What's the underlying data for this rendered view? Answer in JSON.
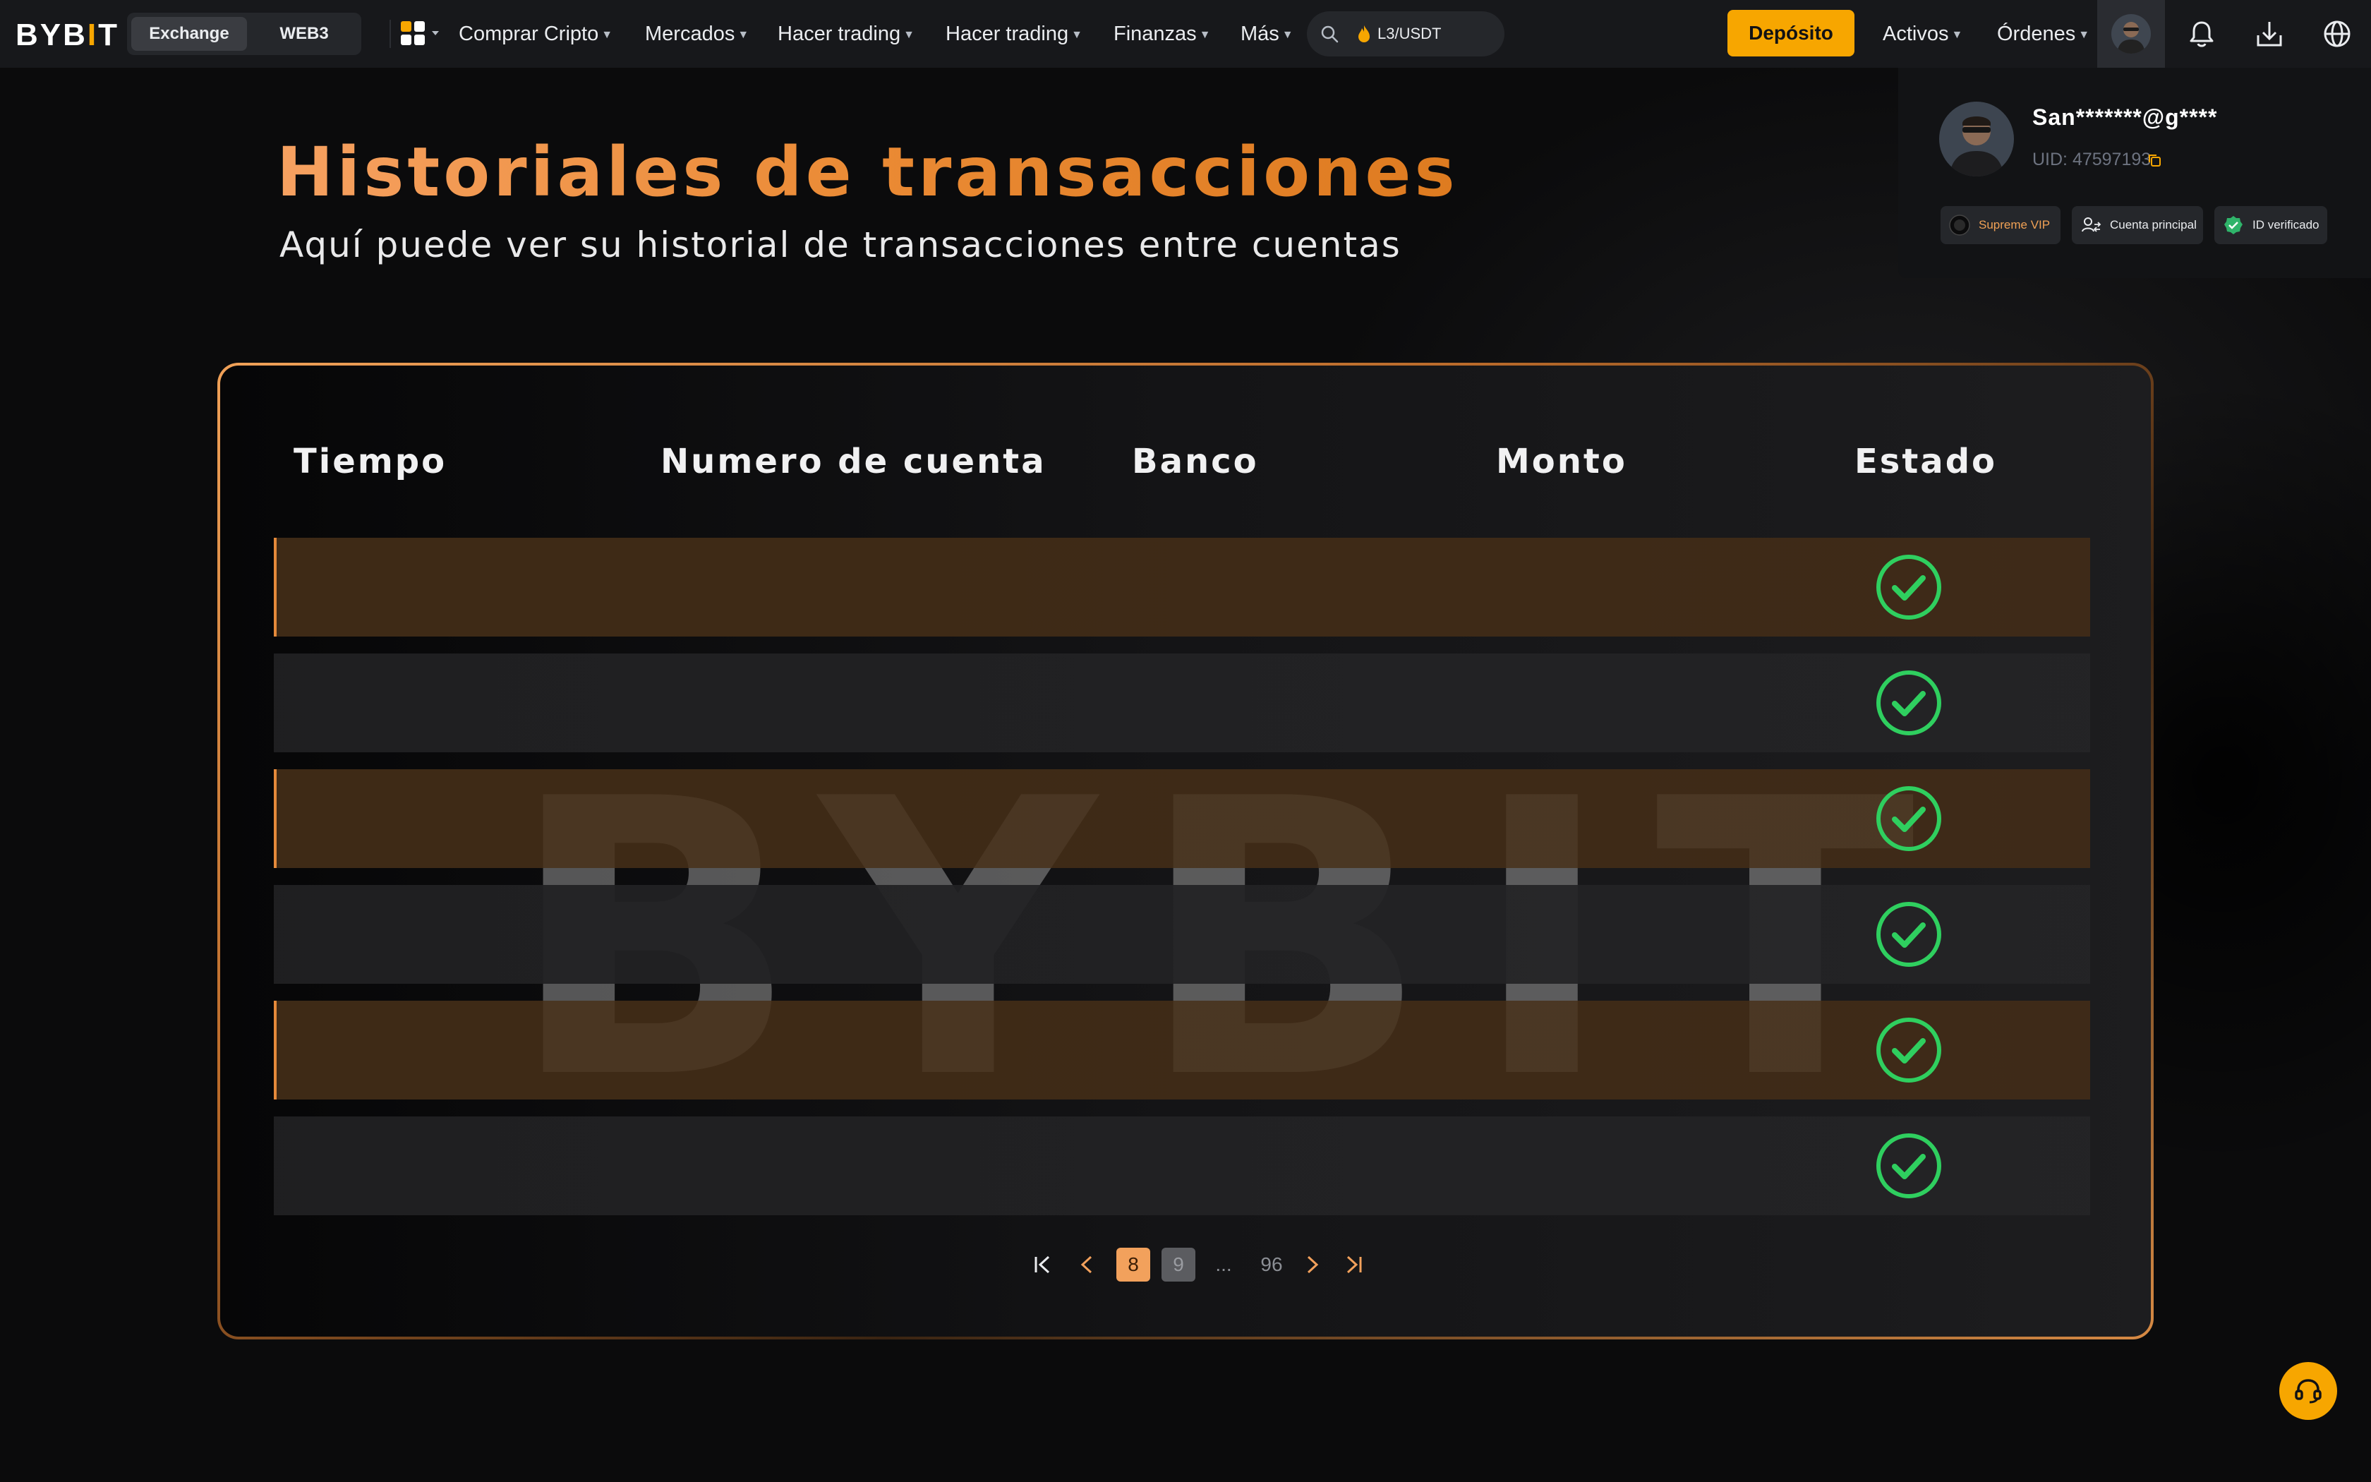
{
  "brand": {
    "logo_text": "BYB",
    "logo_bar": "I",
    "logo_tail": "T",
    "accent": "#f7a600"
  },
  "nav": {
    "segment": {
      "exchange": "Exchange",
      "web3": "WEB3"
    },
    "links": [
      "Comprar Cripto",
      "Mercados",
      "Hacer trading",
      "Hacer trading",
      "Finanzas",
      "Más"
    ],
    "search_text": "L3/USDT",
    "deposit_label": "Depósito",
    "assets_label": "Activos",
    "orders_label": "Órdenes"
  },
  "profile": {
    "email": "San*******@g****",
    "uid": "UID: 47597193",
    "chips": {
      "vip": "Supreme VIP",
      "main_account": "Cuenta principal",
      "verified": "ID verificado"
    }
  },
  "page": {
    "title": "Historiales de transacciones",
    "subtitle": "Aquí puede ver su historial de transacciones entre cuentas"
  },
  "table": {
    "columns": [
      "Tiempo",
      "Numero de cuenta",
      "Banco",
      "Monto",
      "Estado"
    ],
    "rows": [
      {
        "status": "completed"
      },
      {
        "status": "completed"
      },
      {
        "status": "completed"
      },
      {
        "status": "completed"
      },
      {
        "status": "completed"
      },
      {
        "status": "completed"
      }
    ],
    "watermark": "BYBIT",
    "status_color": "#2fcf5f"
  },
  "pagination": {
    "current": "8",
    "next": "9",
    "ellipsis": "...",
    "last": "96"
  }
}
